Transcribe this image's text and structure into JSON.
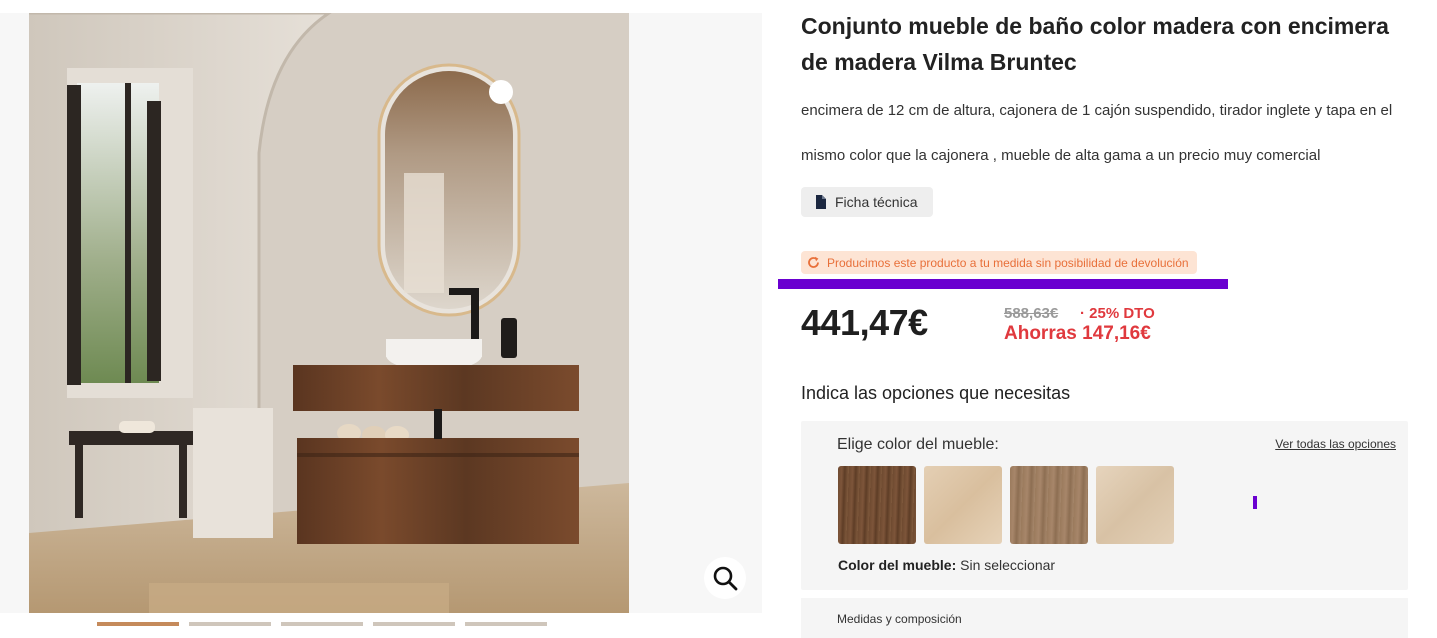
{
  "gallery": {
    "zoom_icon": "search-icon",
    "thumbnail_count": 5,
    "active_thumbnail": 1
  },
  "product": {
    "title": "Conjunto mueble de baño color madera con encimera de madera Vilma Bruntec",
    "description": "encimera de 12 cm de altura, cajonera de 1 cajón suspendido, tirador inglete y tapa en el mismo color que la cajonera , mueble de alta gama a un precio muy comercial",
    "datasheet_label": "Ficha técnica",
    "datasheet_icon": "document-icon",
    "notice": "Producimos este producto a tu medida sin posibilidad de devolución",
    "notice_icon": "refresh-icon"
  },
  "pricing": {
    "current": "441,47€",
    "old": "588,63€",
    "discount": "· 25% DTO",
    "savings": "Ahorras 147,16€"
  },
  "options": {
    "heading": "Indica las opciones que necesitas",
    "color_label": "Elige color del mueble:",
    "see_all": "Ver todas las opciones",
    "swatches": [
      "nogal-oscuro",
      "roble-claro",
      "roble-medio",
      "arce-natural"
    ],
    "status_label": "Color del mueble:",
    "status_value": "Sin seleccionar",
    "measures_label": "Medidas y composición"
  },
  "colors": {
    "accent_purple": "#6a00d0",
    "price_red": "#e0393e",
    "notice_orange": "#e8703a",
    "notice_bg": "#fde4d4"
  }
}
